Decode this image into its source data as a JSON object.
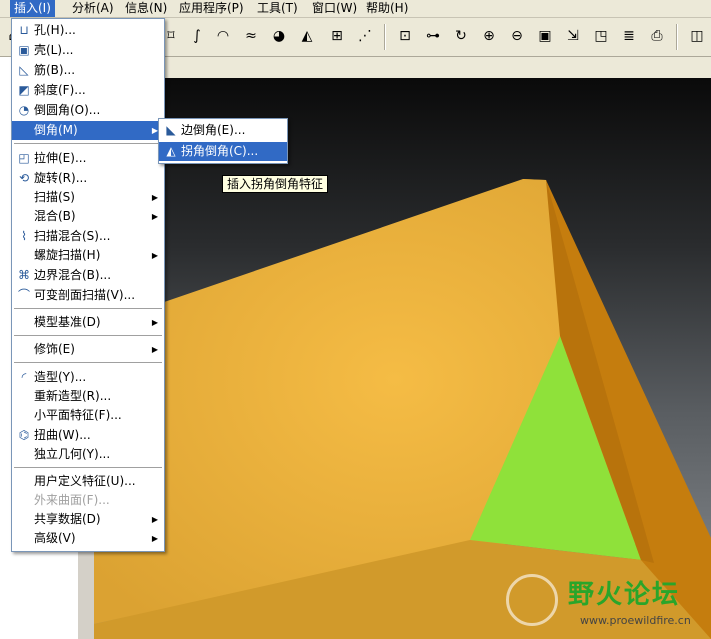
{
  "menubar": [
    {
      "label": "插入(I)"
    },
    {
      "label": "分析(A)"
    },
    {
      "label": "信息(N)"
    },
    {
      "label": "应用程序(P)"
    },
    {
      "label": "工具(T)"
    },
    {
      "label": "窗口(W)"
    },
    {
      "label": "帮助(H)"
    }
  ],
  "insert_menu": [
    {
      "label": "孔(H)...",
      "icon": "hole-icon"
    },
    {
      "label": "壳(L)...",
      "icon": "shell-icon"
    },
    {
      "label": "筋(B)...",
      "icon": "rib-icon"
    },
    {
      "label": "斜度(F)...",
      "icon": "draft-icon"
    },
    {
      "label": "倒圆角(O)...",
      "icon": "round-icon"
    },
    {
      "label": "倒角(M)"
    },
    {
      "label": "拉伸(E)...",
      "icon": "extrude-icon"
    },
    {
      "label": "旋转(R)...",
      "icon": "revolve-icon"
    },
    {
      "label": "扫描(S)"
    },
    {
      "label": "混合(B)"
    },
    {
      "label": "扫描混合(S)...",
      "icon": "swept-blend-icon"
    },
    {
      "label": "螺旋扫描(H)"
    },
    {
      "label": "边界混合(B)...",
      "icon": "boundary-blend-icon"
    },
    {
      "label": "可变剖面扫描(V)...",
      "icon": "variable-section-sweep-icon"
    },
    {
      "label": "模型基准(D)"
    },
    {
      "label": "修饰(E)"
    },
    {
      "label": "造型(Y)...",
      "icon": "style-icon"
    },
    {
      "label": "重新造型(R)..."
    },
    {
      "label": "小平面特征(F)..."
    },
    {
      "label": "扭曲(W)...",
      "icon": "warp-icon"
    },
    {
      "label": "独立几何(Y)..."
    },
    {
      "label": "用户定义特征(U)..."
    },
    {
      "label": "外来曲面(F)..."
    },
    {
      "label": "共享数据(D)"
    },
    {
      "label": "高级(V)"
    }
  ],
  "chamfer_submenu": [
    {
      "label": "边倒角(E)...",
      "icon": "edge-chamfer-icon"
    },
    {
      "label": "拐角倒角(C)...",
      "icon": "corner-chamfer-icon"
    }
  ],
  "tooltip": "插入拐角倒角特征",
  "watermark": {
    "title": "野火论坛",
    "url": "www.proewildfire.cn"
  },
  "colors": {
    "menu_highlight": "#316ac5",
    "face_orange": "#e2a733",
    "face_green": "#8fe13a",
    "edge_dark": "#c07a10"
  }
}
